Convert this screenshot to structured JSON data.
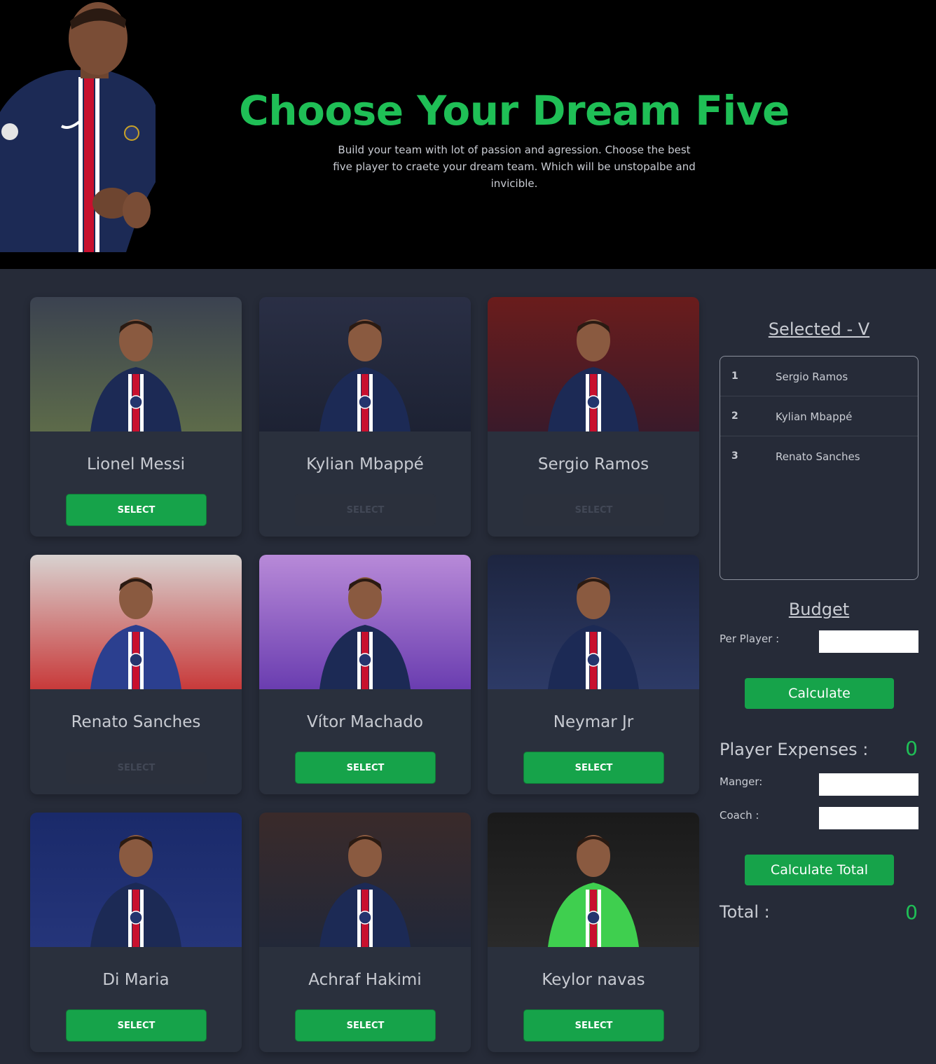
{
  "header": {
    "title": "Choose Your Dream Five",
    "subtitle": "Build your team with lot of passion and agression. Choose the best five player to craete your dream team. Which will be unstopalbe and invicible."
  },
  "players": [
    {
      "name": "Lionel Messi",
      "button": "SELECT",
      "disabled": false
    },
    {
      "name": "Kylian Mbappé",
      "button": "SELECT",
      "disabled": true
    },
    {
      "name": "Sergio Ramos",
      "button": "SELECT",
      "disabled": true
    },
    {
      "name": "Renato Sanches",
      "button": "SELECT",
      "disabled": true
    },
    {
      "name": "Vítor Machado",
      "button": "SELECT",
      "disabled": false
    },
    {
      "name": "Neymar Jr",
      "button": "SELECT",
      "disabled": false
    },
    {
      "name": "Di Maria",
      "button": "SELECT",
      "disabled": false
    },
    {
      "name": "Achraf Hakimi",
      "button": "SELECT",
      "disabled": false
    },
    {
      "name": "Keylor navas",
      "button": "SELECT",
      "disabled": false
    }
  ],
  "sidebar": {
    "selected_title": "Selected - V",
    "selected": [
      {
        "num": "1",
        "name": "Sergio Ramos"
      },
      {
        "num": "2",
        "name": "Kylian Mbappé"
      },
      {
        "num": "3",
        "name": "Renato Sanches"
      }
    ],
    "budget_title": "Budget",
    "per_player_label": "Per Player :",
    "per_player_value": "",
    "calculate_label": "Calculate",
    "player_expenses_label": "Player Expenses :",
    "player_expenses_value": "0",
    "manager_label": "Manger:",
    "manager_value": "",
    "coach_label": "Coach :",
    "coach_value": "",
    "calculate_total_label": "Calculate Total",
    "total_label": "Total :",
    "total_value": "0"
  },
  "colors": {
    "accent": "#1fbf56",
    "button": "#16a34a",
    "background": "#262b38",
    "card": "#2a303d",
    "header": "#000000"
  }
}
